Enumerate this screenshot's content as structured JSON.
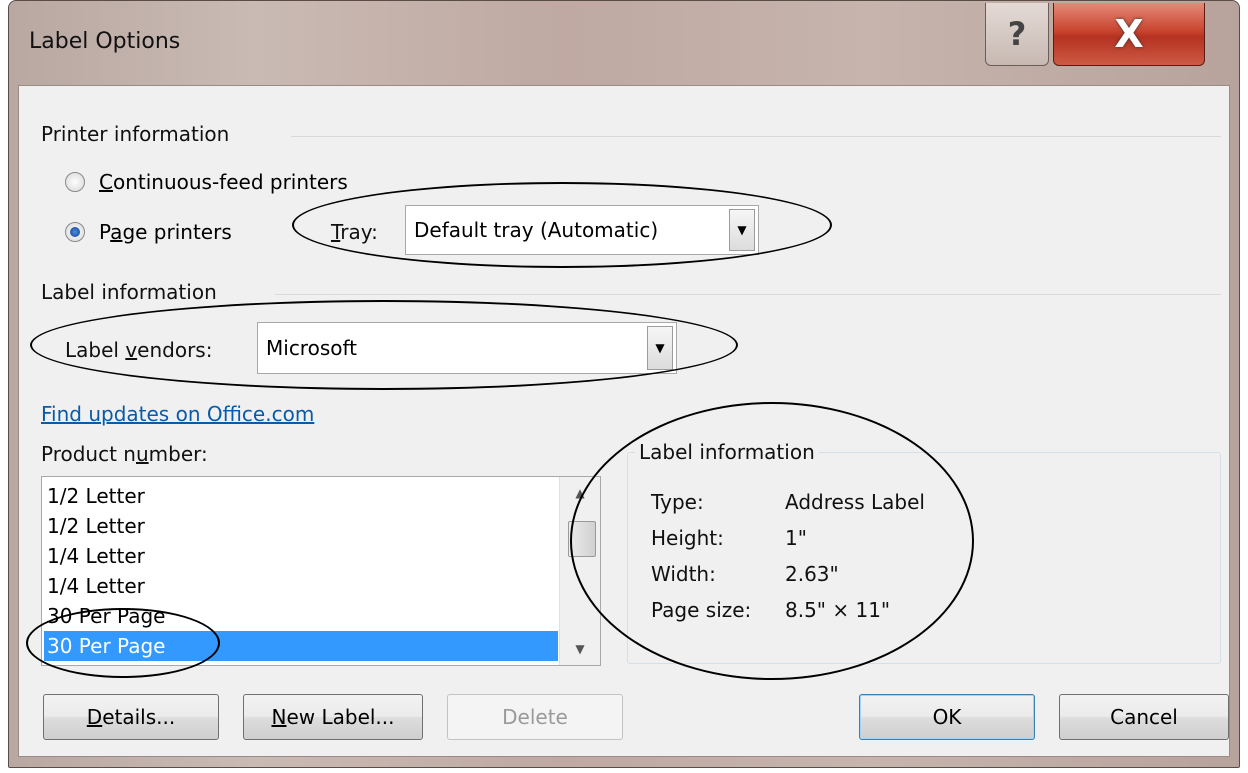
{
  "window": {
    "title": "Label Options",
    "help_glyph": "?",
    "close_glyph": "X"
  },
  "printer_info": {
    "section_title": "Printer information",
    "continuous": {
      "pre": "",
      "acc": "C",
      "post": "ontinuous-feed printers",
      "checked": false
    },
    "page": {
      "pre": "P",
      "acc": "a",
      "post": "ge printers",
      "checked": true
    },
    "tray_label": {
      "pre": "",
      "acc": "T",
      "post": "ray:"
    },
    "tray_value": "Default tray (Automatic)"
  },
  "label_info_section": {
    "section_title": "Label information",
    "vendors_label": {
      "pre": "Label ",
      "acc": "v",
      "post": "endors:"
    },
    "vendors_value": "Microsoft",
    "link": "Find updates on Office.com",
    "product_label": {
      "pre": "Product n",
      "acc": "u",
      "post": "mber:"
    }
  },
  "product_list": {
    "items": [
      {
        "text": "1/2 Letter",
        "selected": false
      },
      {
        "text": "1/2 Letter",
        "selected": false
      },
      {
        "text": "1/4 Letter",
        "selected": false
      },
      {
        "text": "1/4 Letter",
        "selected": false
      },
      {
        "text": "30 Per Page",
        "selected": false
      },
      {
        "text": "30 Per Page",
        "selected": true
      }
    ]
  },
  "details_box": {
    "title": "Label information",
    "type_label": "Type:",
    "type_value": "Address Label",
    "height_label": "Height:",
    "height_value": "1\"",
    "width_label": "Width:",
    "width_value": "2.63\"",
    "page_size_label": "Page size:",
    "page_size_value": "8.5\" × 11\""
  },
  "buttons": {
    "details": {
      "pre": "",
      "acc": "D",
      "post": "etails..."
    },
    "new_label": {
      "pre": "",
      "acc": "N",
      "post": "ew Label..."
    },
    "delete": "Delete",
    "ok": "OK",
    "cancel": "Cancel"
  },
  "colors": {
    "selection": "#3399ff",
    "link": "#0b5aa8",
    "close_button": "#c9452f"
  }
}
